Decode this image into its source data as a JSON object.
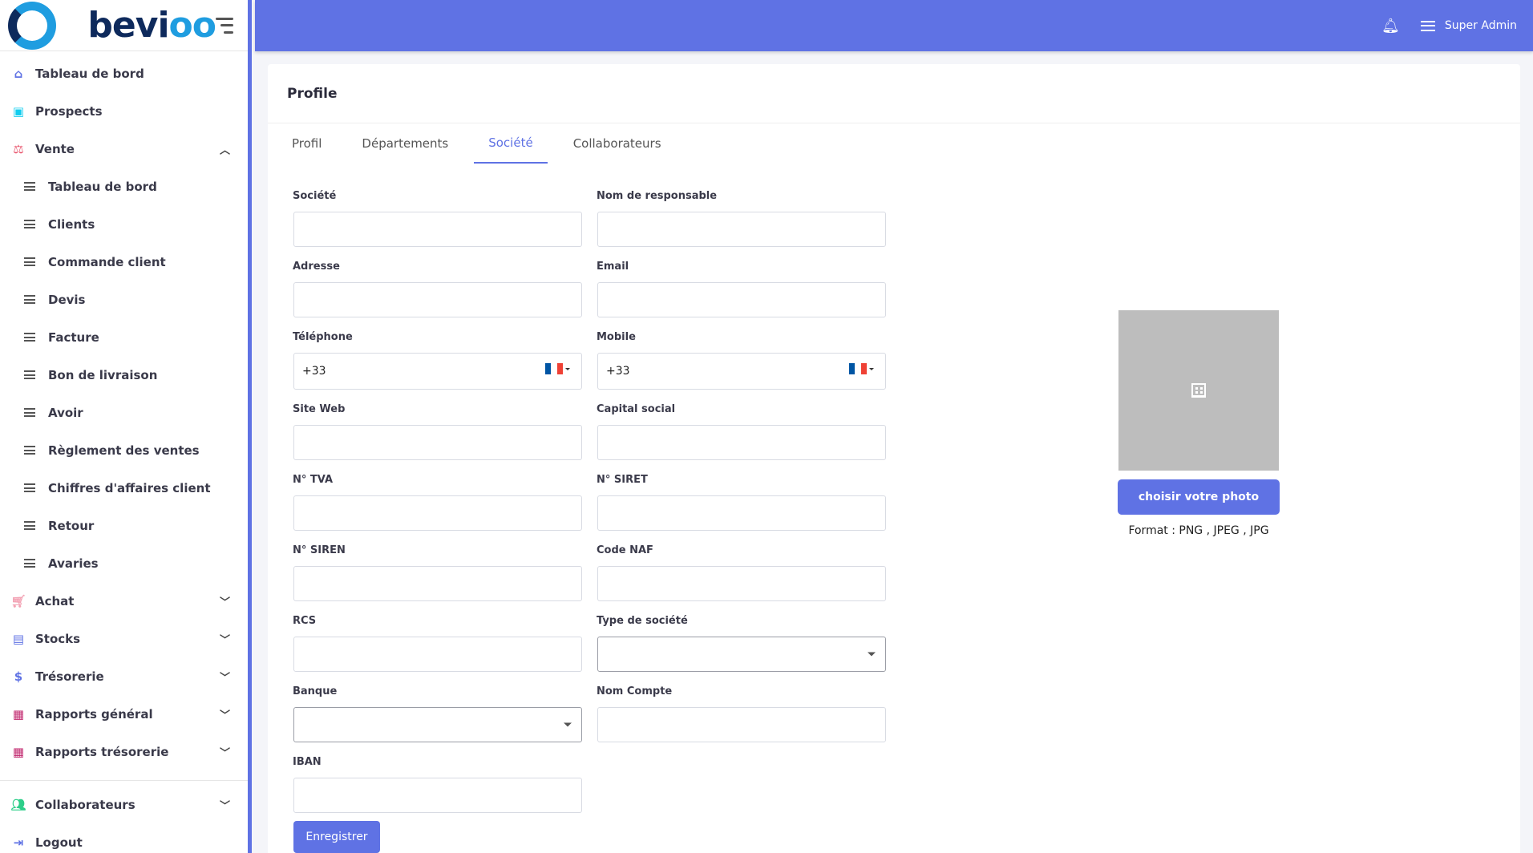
{
  "logo": {
    "text_main": "bevi",
    "text_accent": "oo"
  },
  "sidebar": {
    "items": [
      {
        "label": "Tableau de bord",
        "icon": "home-icon",
        "color": "#5f72e4"
      },
      {
        "label": "Prospects",
        "icon": "contact-icon",
        "color": "#11cdef"
      },
      {
        "label": "Vente",
        "icon": "scale-icon",
        "color": "#e8536b",
        "expanded": true
      },
      {
        "label": "Achat",
        "icon": "cart-icon",
        "color": "#f3a4b5"
      },
      {
        "label": "Stocks",
        "icon": "store-icon",
        "color": "#5f72e4"
      },
      {
        "label": "Trésorerie",
        "icon": "dollar-icon",
        "color": "#5f72e4"
      },
      {
        "label": "Rapports général",
        "icon": "report-icon",
        "color": "#c0266d"
      },
      {
        "label": "Rapports trésorerie",
        "icon": "report-icon",
        "color": "#c0266d"
      },
      {
        "label": "Collaborateurs",
        "icon": "users-icon",
        "color": "#2dce89"
      },
      {
        "label": "Logout",
        "icon": "logout-icon",
        "color": "#5f72e4"
      }
    ],
    "vente_sub": [
      "Tableau de bord",
      "Clients",
      "Commande client",
      "Devis",
      "Facture",
      "Bon de livraison",
      "Avoir",
      "Règlement des ventes",
      "Chiffres d'affaires client",
      "Retour",
      "Avaries"
    ]
  },
  "topbar": {
    "user": "Super Admin",
    "bg": "#5f72e4"
  },
  "card": {
    "title": "Profile"
  },
  "tabs": [
    "Profil",
    "Départements",
    "Société",
    "Collaborateurs"
  ],
  "active_tab": "Société",
  "form": {
    "societe": "Société",
    "nom_responsable": "Nom de responsable",
    "adresse": "Adresse",
    "email": "Email",
    "telephone": "Téléphone",
    "telephone_value": "+33",
    "mobile": "Mobile",
    "mobile_value": "+33",
    "site_web": "Site Web",
    "capital_social": "Capital social",
    "tva": "N° TVA",
    "siret": "N° SIRET",
    "siren": "N° SIREN",
    "code_naf": "Code NAF",
    "rcs": "RCS",
    "type_societe": "Type de société",
    "banque": "Banque",
    "nom_compte": "Nom Compte",
    "iban": "IBAN",
    "save": "Enregistrer"
  },
  "photo": {
    "button": "choisir votre photo",
    "format": "Format : PNG , JPEG , JPG"
  }
}
